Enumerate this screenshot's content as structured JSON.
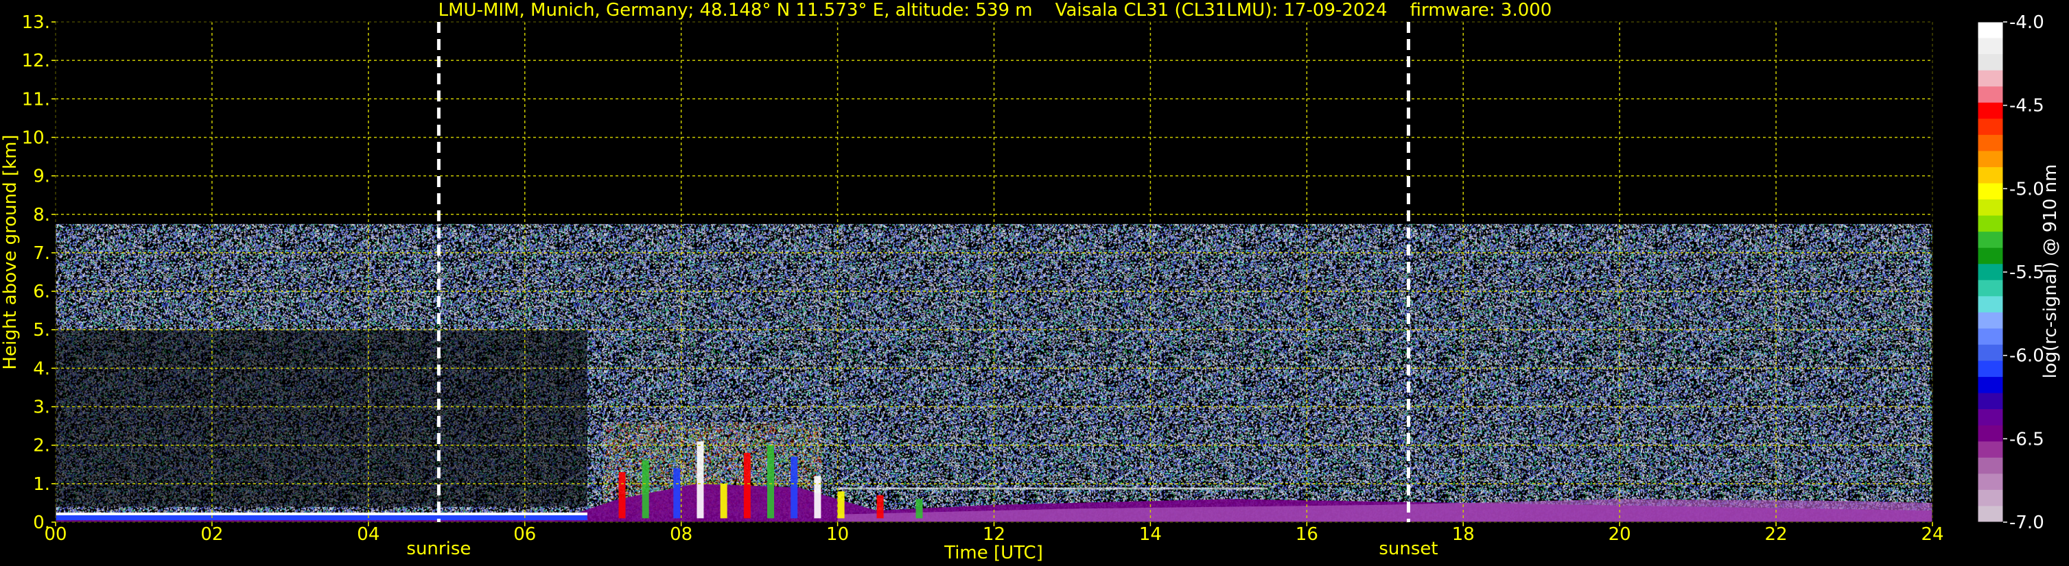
{
  "chart_data": {
    "type": "heatmap",
    "title": "LMU-MIM, Munich, Germany; 48.148° N 11.573° E, altitude: 539 m    Vaisala CL31 (CL31LMU): 17-09-2024    firmware: 3.000",
    "xlabel": "Time [UTC]",
    "ylabel": "Height above ground [km]",
    "xlim": [
      0,
      24
    ],
    "ylim": [
      0,
      13
    ],
    "x_ticks": [
      "00",
      "02",
      "04",
      "06",
      "08",
      "10",
      "12",
      "14",
      "16",
      "18",
      "20",
      "22",
      "24"
    ],
    "y_ticks": [
      "0.",
      "1.",
      "2.",
      "3.",
      "4.",
      "5.",
      "6.",
      "7.",
      "8.",
      "9.",
      "10.",
      "11.",
      "12.",
      "13."
    ],
    "grid": true,
    "annotations": [
      {
        "label": "sunrise",
        "x": 4.9
      },
      {
        "label": "sunset",
        "x": 17.3
      }
    ],
    "colorbar": {
      "label": "log(rc-signal) @ 910 nm",
      "range": [
        -7.0,
        -4.0
      ],
      "ticks": [
        "-4.0",
        "-4.5",
        "-5.0",
        "-5.5",
        "-6.0",
        "-6.5",
        "-7.0"
      ],
      "colors": [
        "#ffffff",
        "#f0f0f0",
        "#e6e6e6",
        "#f2b6c0",
        "#f27a8c",
        "#ff0000",
        "#ff3300",
        "#ff6600",
        "#ff9900",
        "#ffcc00",
        "#ffff00",
        "#ccee00",
        "#88dd00",
        "#33bb33",
        "#119911",
        "#00aa88",
        "#33ccaa",
        "#66dddd",
        "#88aaff",
        "#6688ff",
        "#4466ee",
        "#2244ff",
        "#0000dd",
        "#3300aa",
        "#660099",
        "#770088",
        "#993399",
        "#aa66aa",
        "#bb88bb",
        "#c8a8c8",
        "#d0c0d0"
      ]
    },
    "data_description": {
      "signal_top_km": 7.75,
      "boundary_layer": [
        {
          "t": 0,
          "top_km": 0.2
        },
        {
          "t": 6.5,
          "top_km": 0.25
        },
        {
          "t": 7.2,
          "top_km": 1.2
        },
        {
          "t": 8.2,
          "top_km": 2.0
        },
        {
          "t": 9.5,
          "top_km": 1.8
        },
        {
          "t": 10.5,
          "top_km": 0.6
        },
        {
          "t": 12,
          "top_km": 0.9
        },
        {
          "t": 15,
          "top_km": 1.2
        },
        {
          "t": 24,
          "top_km": 0.6
        }
      ]
    }
  }
}
